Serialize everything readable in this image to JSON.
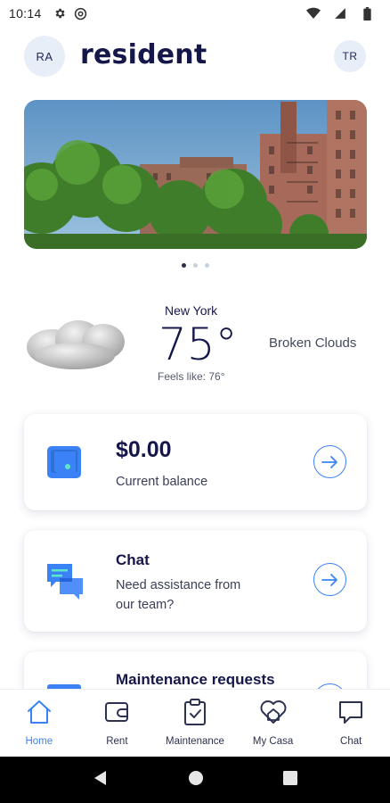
{
  "status_bar": {
    "time": "10:14",
    "icons": [
      "gear-icon",
      "at-icon",
      "wifi-icon",
      "signal-icon",
      "battery-icon"
    ]
  },
  "header": {
    "user_initials": "RA",
    "brand": "resident",
    "tenant_initials": "TR"
  },
  "hero": {
    "image": "apartment-building-photo",
    "slides": 3,
    "active_slide": 1
  },
  "weather": {
    "city": "New York",
    "temperature": "75°",
    "feels_like": "Feels like: 76°",
    "conditions": "Broken Clouds",
    "icon": "cloud-icon"
  },
  "cards": [
    {
      "icon": "wallet-icon",
      "title": "$0.00",
      "subtitle": "Current balance"
    },
    {
      "icon": "chat-bubbles-icon",
      "title": "Chat",
      "subtitle_line1": "Need assistance from",
      "subtitle_line2": "our team?"
    },
    {
      "icon": "maintenance-icon",
      "title": "Maintenance requests"
    }
  ],
  "bottom_nav": [
    {
      "label": "Home",
      "icon": "home-icon",
      "active": true
    },
    {
      "label": "Rent",
      "icon": "wallet-outline-icon"
    },
    {
      "label": "Maintenance",
      "icon": "clipboard-check-icon"
    },
    {
      "label": "My Casa",
      "icon": "heart-house-icon"
    },
    {
      "label": "Chat",
      "icon": "chat-outline-icon"
    }
  ],
  "colors": {
    "accent": "#3b82f6",
    "brand_text": "#15174a",
    "avatar_bg": "#e7eef8"
  }
}
